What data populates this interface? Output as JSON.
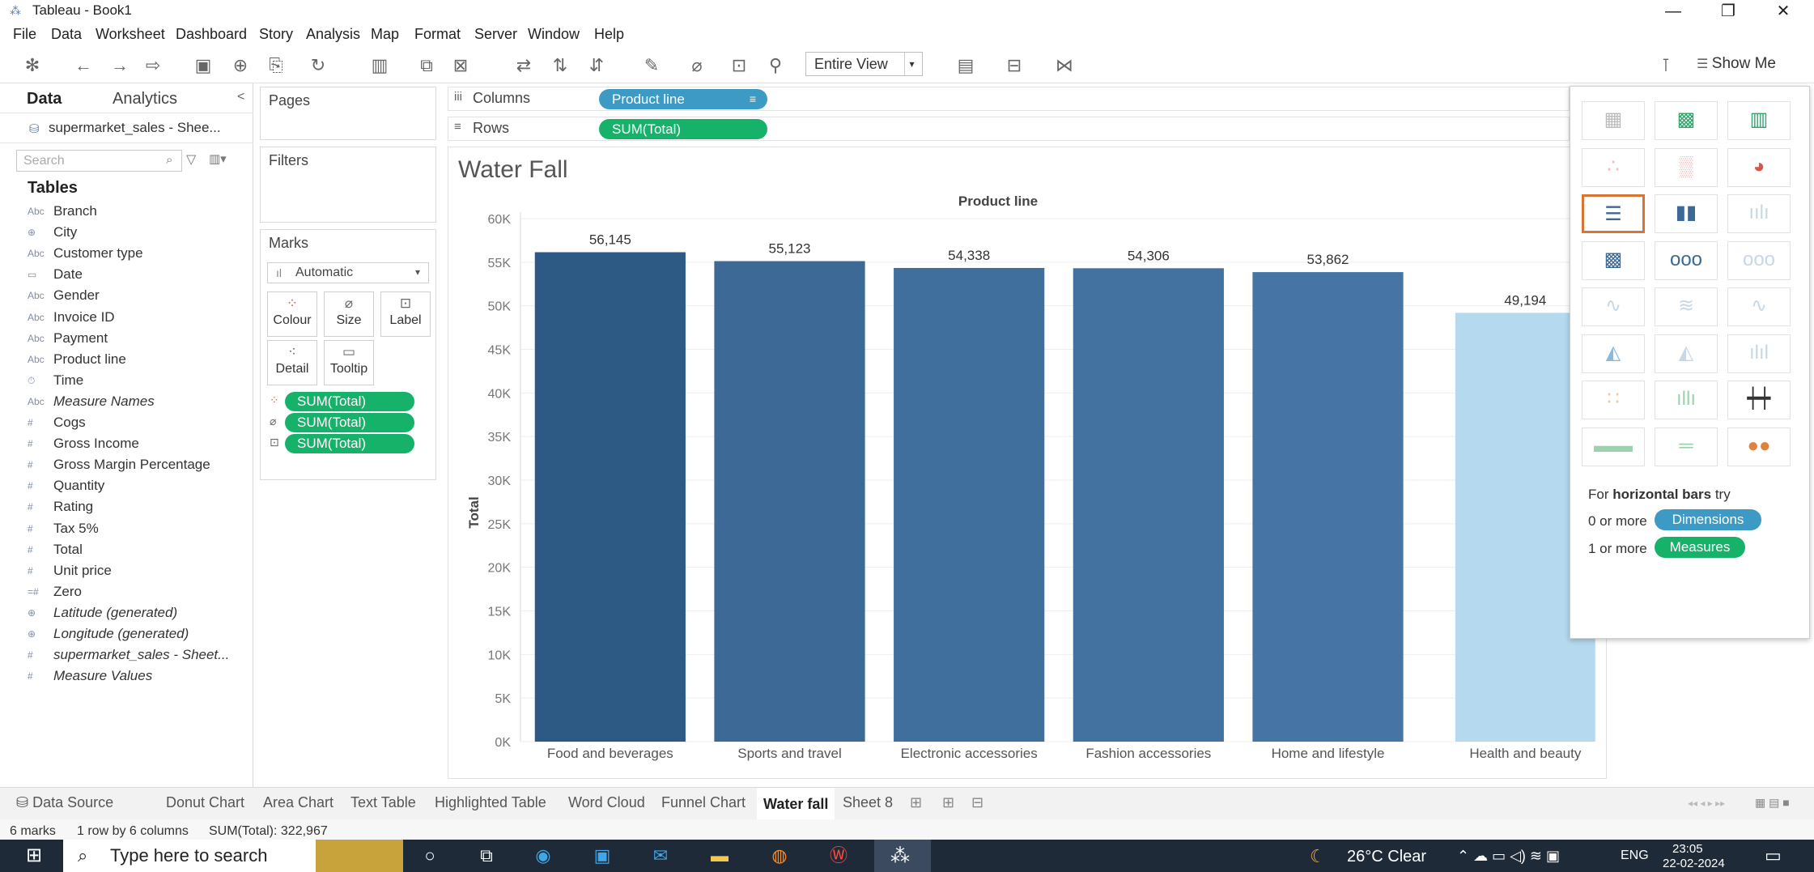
{
  "window": {
    "title": "Tableau - Book1",
    "minimize": "—",
    "maximize": "❐",
    "close": "✕"
  },
  "menu": [
    "File",
    "Data",
    "Worksheet",
    "Dashboard",
    "Story",
    "Analysis",
    "Map",
    "Format",
    "Server",
    "Window",
    "Help"
  ],
  "toolbar": {
    "view_mode": "Entire View",
    "show_me_label": "Show Me"
  },
  "data_pane": {
    "tab_data": "Data",
    "tab_analytics": "Analytics",
    "collapse": "<",
    "datasource": "supermarket_sales - Shee...",
    "search_placeholder": "Search",
    "tables_heading": "Tables",
    "fields": [
      {
        "icon": "Abc",
        "name": "Branch",
        "italic": false
      },
      {
        "icon": "⊕",
        "name": "City",
        "italic": false
      },
      {
        "icon": "Abc",
        "name": "Customer type",
        "italic": false
      },
      {
        "icon": "▭",
        "name": "Date",
        "italic": false
      },
      {
        "icon": "Abc",
        "name": "Gender",
        "italic": false
      },
      {
        "icon": "Abc",
        "name": "Invoice ID",
        "italic": false
      },
      {
        "icon": "Abc",
        "name": "Payment",
        "italic": false
      },
      {
        "icon": "Abc",
        "name": "Product line",
        "italic": false
      },
      {
        "icon": "⏱",
        "name": "Time",
        "italic": false
      },
      {
        "icon": "Abc",
        "name": "Measure Names",
        "italic": true
      },
      {
        "icon": "#",
        "name": "Cogs",
        "italic": false
      },
      {
        "icon": "#",
        "name": "Gross Income",
        "italic": false
      },
      {
        "icon": "#",
        "name": "Gross Margin Percentage",
        "italic": false
      },
      {
        "icon": "#",
        "name": "Quantity",
        "italic": false
      },
      {
        "icon": "#",
        "name": "Rating",
        "italic": false
      },
      {
        "icon": "#",
        "name": "Tax 5%",
        "italic": false
      },
      {
        "icon": "#",
        "name": "Total",
        "italic": false
      },
      {
        "icon": "#",
        "name": "Unit price",
        "italic": false
      },
      {
        "icon": "=#",
        "name": "Zero",
        "italic": false
      },
      {
        "icon": "⊕",
        "name": "Latitude (generated)",
        "italic": true
      },
      {
        "icon": "⊕",
        "name": "Longitude (generated)",
        "italic": true
      },
      {
        "icon": "#",
        "name": "supermarket_sales - Sheet...",
        "italic": true
      },
      {
        "icon": "#",
        "name": "Measure Values",
        "italic": true
      }
    ]
  },
  "cards": {
    "pages_title": "Pages",
    "filters_title": "Filters",
    "marks_title": "Marks",
    "mark_type": "Automatic",
    "buttons": {
      "colour": "Colour",
      "size": "Size",
      "label": "Label",
      "detail": "Detail",
      "tooltip": "Tooltip"
    },
    "mark_pills": [
      "SUM(Total)",
      "SUM(Total)",
      "SUM(Total)"
    ]
  },
  "shelves": {
    "columns_label": "Columns",
    "rows_label": "Rows",
    "columns_pill": "Product line",
    "rows_pill": "SUM(Total)"
  },
  "sheet_title": "Water Fall",
  "chart_data": {
    "type": "bar",
    "title": "Water Fall",
    "header": "Product line",
    "ylabel": "Total",
    "xlabel": "",
    "categories": [
      "Food and beverages",
      "Sports and travel",
      "Electronic accessories",
      "Fashion accessories",
      "Home and lifestyle",
      "Health and beauty"
    ],
    "values": [
      56145,
      55123,
      54338,
      54306,
      53862,
      49194
    ],
    "value_labels": [
      "56,145",
      "55,123",
      "54,338",
      "54,306",
      "53,862",
      "49,194"
    ],
    "ylim": [
      0,
      60000
    ],
    "yticks": [
      "0K",
      "5K",
      "10K",
      "15K",
      "20K",
      "25K",
      "30K",
      "35K",
      "40K",
      "45K",
      "50K",
      "55K",
      "60K"
    ],
    "color_encoding": "SUM(Total)",
    "colors": [
      "#2c5a85",
      "#3d6996",
      "#416f9d",
      "#4371a0",
      "#4574a5",
      "#b5d9ee"
    ],
    "grid": true
  },
  "show_me": {
    "hint_prefix": "For ",
    "hint_bold": "horizontal bars",
    "hint_suffix": " try",
    "dim_prefix": "0 or more",
    "dim_badge": "Dimensions",
    "meas_prefix": "1 or more",
    "meas_badge": "Measures",
    "dimension_color": "#3d9ac4",
    "measure_color": "#17b26a"
  },
  "sheet_tabs": [
    "Data Source",
    "Donut Chart",
    "Area Chart",
    "Text Table",
    "Highlighted Table",
    "Word Cloud",
    "Funnel Chart",
    "Water fall",
    "Sheet 8"
  ],
  "active_tab": "Water fall",
  "status": {
    "marks": "6 marks",
    "dims": "1 row by 6 columns",
    "sum": "SUM(Total): 322,967"
  },
  "taskbar": {
    "search_placeholder": "Type here to search",
    "weather": "26°C  Clear",
    "lang": "ENG",
    "time": "23:05",
    "date": "22-02-2024"
  }
}
